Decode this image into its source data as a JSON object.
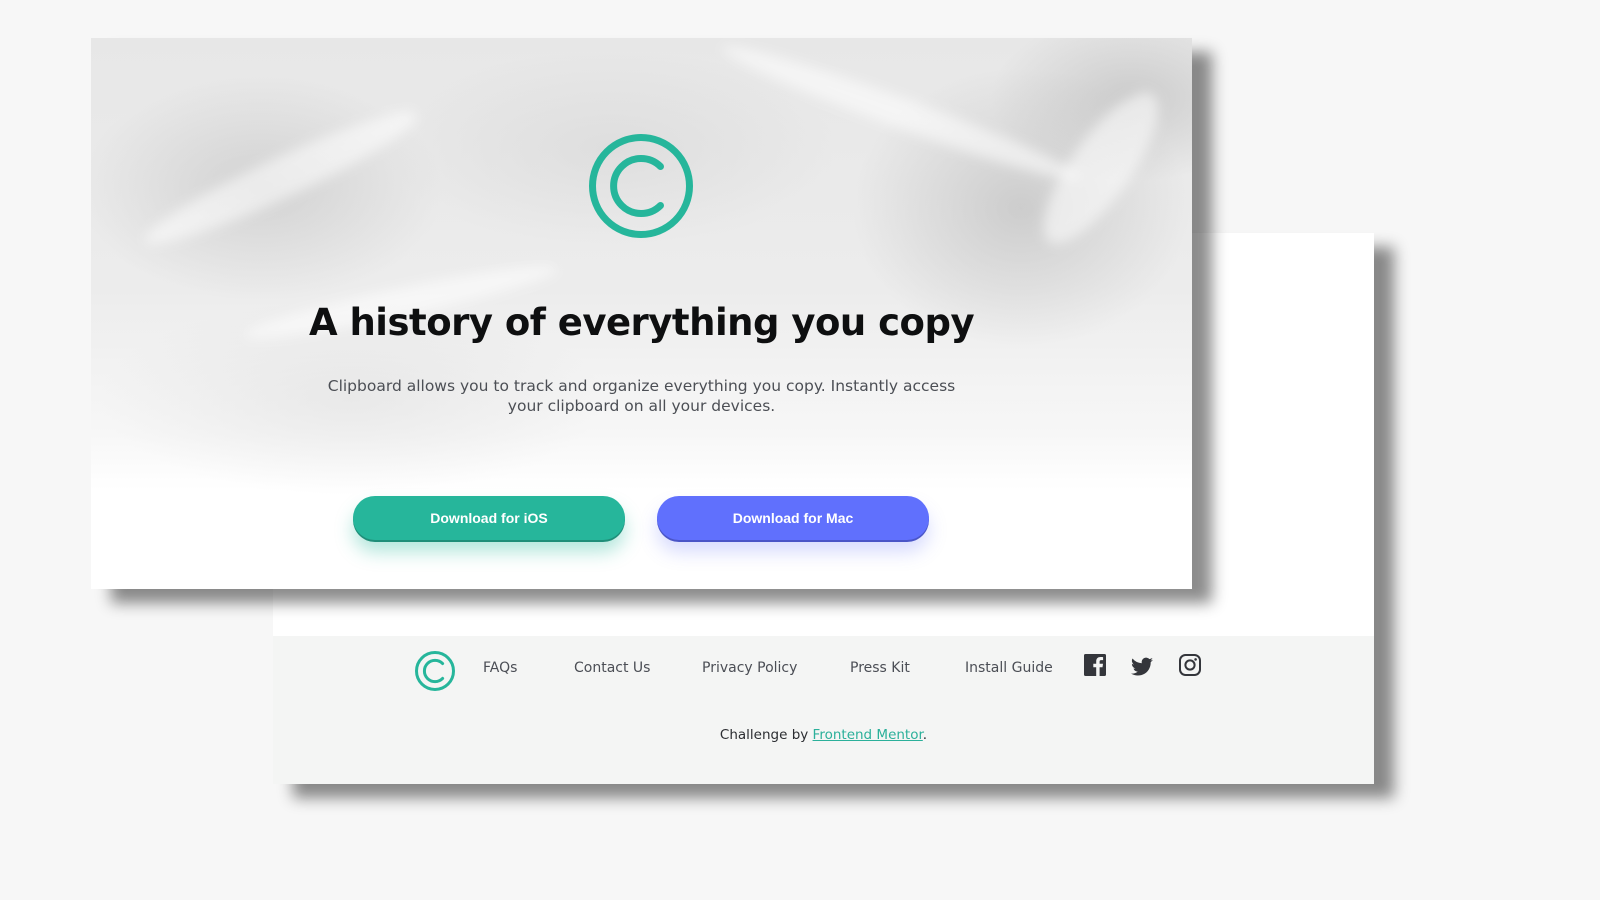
{
  "hero": {
    "title": "A history of everything you copy",
    "subtitle": "Clipboard allows you to track and organize everything you copy. Instantly access your clipboard on all your devices.",
    "ios_button": "Download for iOS",
    "mac_button": "Download for Mac"
  },
  "footer": {
    "links": [
      "FAQs",
      "Contact Us",
      "Privacy Policy",
      "Press Kit",
      "Install Guide"
    ],
    "social_icons": [
      "facebook-icon",
      "twitter-icon",
      "instagram-icon"
    ],
    "attribution_prefix": "Challenge by ",
    "attribution_link": "Frontend Mentor",
    "attribution_suffix": "."
  },
  "colors": {
    "brand_teal": "#26b69b",
    "mac_blue": "#6070fd",
    "page_bg": "#f7f7f7",
    "footer_bg": "#f4f5f4",
    "heading": "#0e0f10",
    "body_text": "#4c4f55"
  }
}
